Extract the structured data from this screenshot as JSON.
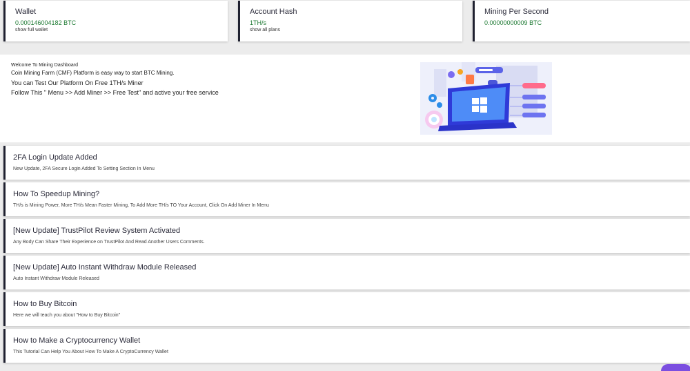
{
  "stats": [
    {
      "title": "Wallet",
      "value": "0.000146004182 BTC",
      "link": "show full wallet"
    },
    {
      "title": "Account Hash",
      "value": "1TH/s",
      "link": "show all plans"
    },
    {
      "title": "Mining Per Second",
      "value": "0.00000000009 BTC",
      "link": ""
    }
  ],
  "welcome": {
    "heading": "Welcome To Mining Dashboard",
    "line1": "Coin Mining Farm (CMF) Platform is easy way to start BTC Mining.",
    "line2": "You can Test Our Platform On Free 1TH/s Miner",
    "line3": "Follow This \" Menu >> Add Miner >> Free Test\" and active your free service"
  },
  "news": [
    {
      "title": "2FA Login Update Added",
      "desc": "New Update, 2FA Secure Login Added To Setting Section In Menu"
    },
    {
      "title": "How To Speedup Mining?",
      "desc": "TH/s is Mining Power, More TH/s Mean Faster Mining, To Add More TH/s TO Your Account, Click On Add Miner In Menu"
    },
    {
      "title": "[New Update] TrustPilot Review System Activated",
      "desc": "Any Body Can Share Their Experience on TrustPilot And Read Another Users Comments."
    },
    {
      "title": "[New Update] Auto Instant Withdraw Module Released",
      "desc": "Auto Instant Withdraw Module Released"
    },
    {
      "title": "How to Buy Bitcoin",
      "desc": "Here we will teach you about \"How to Buy Bitcoin\""
    },
    {
      "title": "How to Make a Cryptocurrency Wallet",
      "desc": "This Tutorial Can Help You About How To Make A CryptoCurrency Wallet"
    }
  ],
  "icons": {
    "illustration": "windows-laptop-illustration"
  }
}
